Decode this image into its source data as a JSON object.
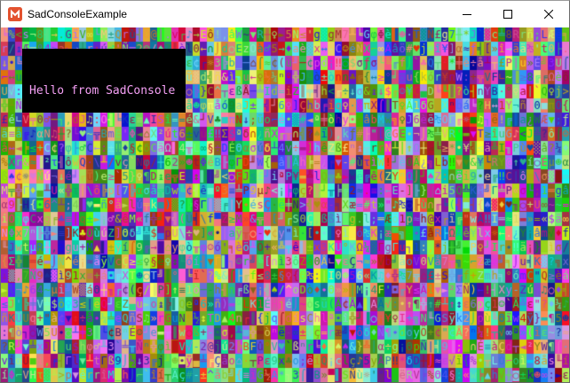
{
  "window": {
    "title": "SadConsoleExample",
    "icon": "monogame-icon",
    "controls": [
      "minimize-icon",
      "maximize-icon",
      "close-icon"
    ]
  },
  "console": {
    "hello_text": "Hello from SadConsole",
    "hello_color": "#f5a0f5",
    "panel_color": "#000000",
    "background_color": "#000000"
  }
}
